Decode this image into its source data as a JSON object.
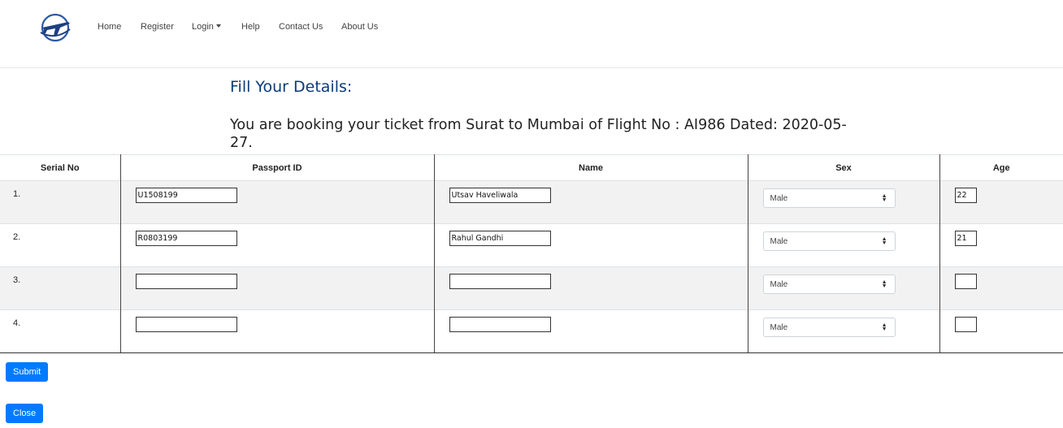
{
  "nav": {
    "items": [
      {
        "label": "Home"
      },
      {
        "label": "Register"
      },
      {
        "label": "Login"
      },
      {
        "label": "Help"
      },
      {
        "label": "Contact Us"
      },
      {
        "label": "About Us"
      }
    ]
  },
  "colors": {
    "brand": "#0b3b7a",
    "primary": "#007bff",
    "stripe": "#f2f2f2"
  },
  "icons": {
    "logo": "airplane-globe-icon",
    "dropdown": "caret-down-icon",
    "select": "select-arrows-icon"
  },
  "headings": {
    "fill": "Fill Your Details:",
    "booking": "You are booking your ticket from Surat to Mumbai of Flight No : AI986 Dated: 2020-05-27."
  },
  "table": {
    "headers": [
      "Serial No",
      "Passport ID",
      "Name",
      "Sex",
      "Age"
    ],
    "rows": [
      {
        "serial": "1.",
        "passport": "U1508199",
        "name": "Utsav Haveliwala",
        "sex": "Male",
        "age": "22"
      },
      {
        "serial": "2.",
        "passport": "R0803199",
        "name": "Rahul Gandhi",
        "sex": "Male",
        "age": "21"
      },
      {
        "serial": "3.",
        "passport": "",
        "name": "",
        "sex": "Male",
        "age": ""
      },
      {
        "serial": "4.",
        "passport": "",
        "name": "",
        "sex": "Male",
        "age": ""
      }
    ]
  },
  "buttons": {
    "submit": "Submit",
    "close": "Close"
  }
}
